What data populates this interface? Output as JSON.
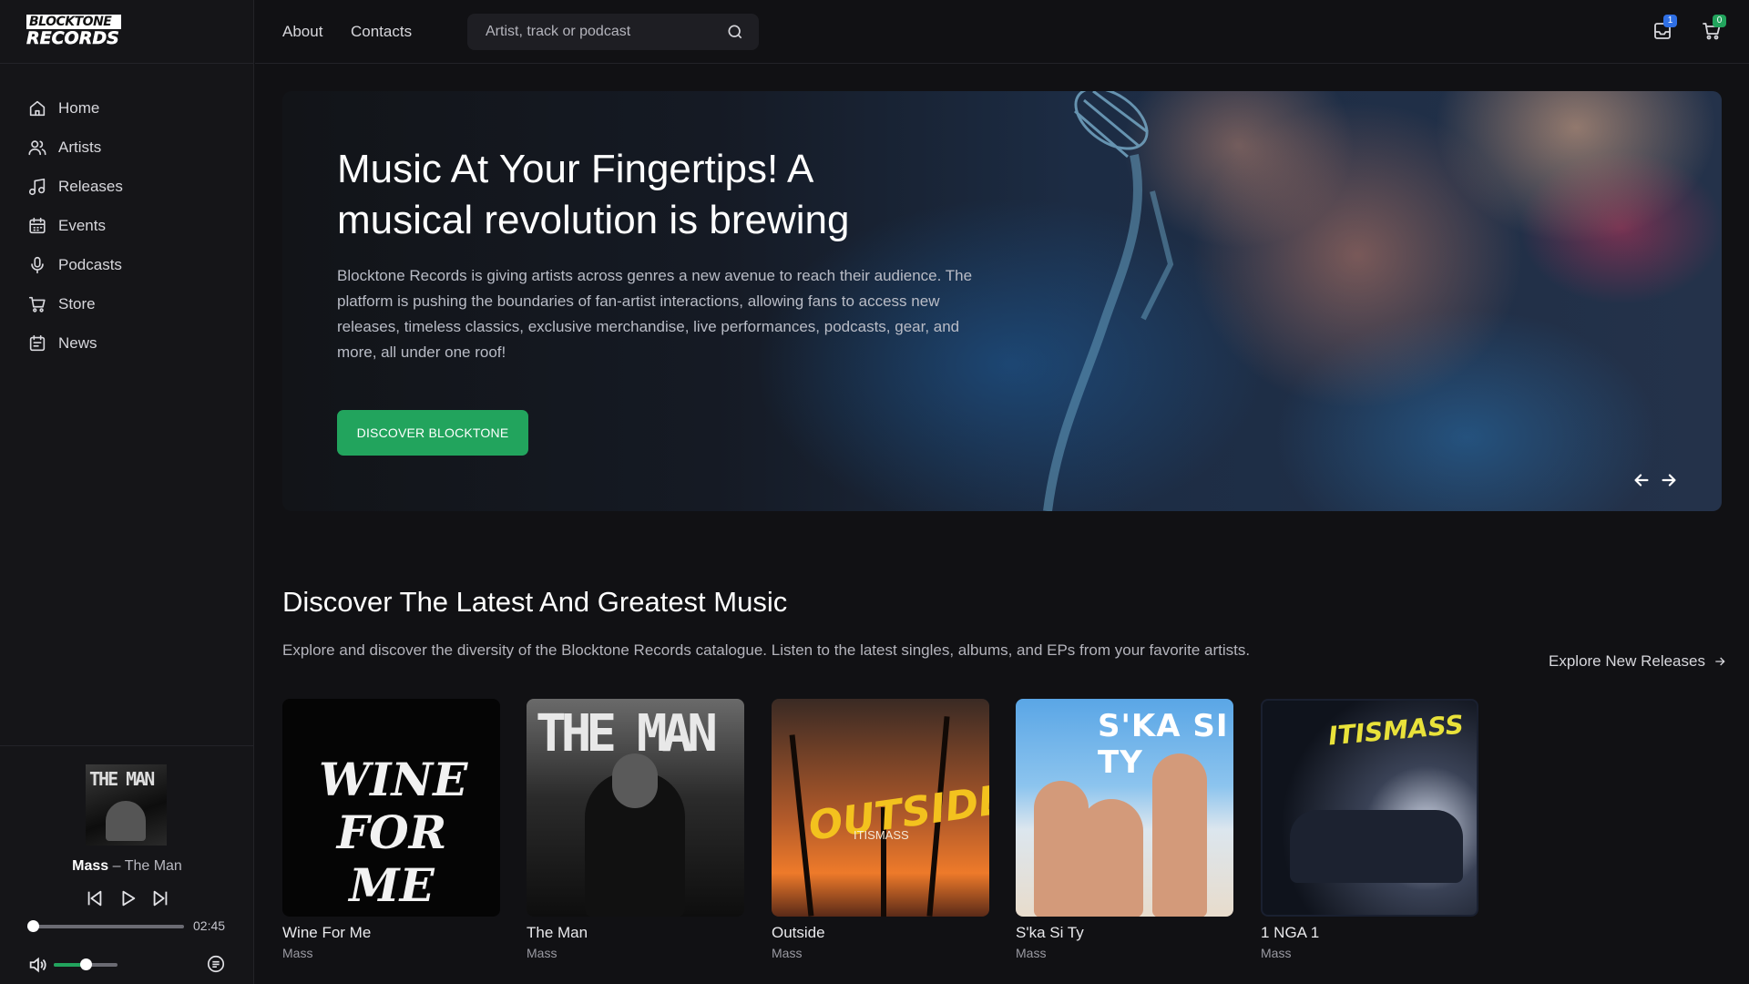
{
  "brand": {
    "line1": "BLOCKTONE",
    "line2": "RECORDS"
  },
  "sidebar": {
    "items": [
      {
        "label": "Home",
        "icon": "home-icon"
      },
      {
        "label": "Artists",
        "icon": "users-icon"
      },
      {
        "label": "Releases",
        "icon": "music-note-icon"
      },
      {
        "label": "Events",
        "icon": "calendar-icon"
      },
      {
        "label": "Podcasts",
        "icon": "microphone-icon"
      },
      {
        "label": "Store",
        "icon": "cart-icon"
      },
      {
        "label": "News",
        "icon": "news-icon"
      }
    ]
  },
  "player": {
    "artist": "Mass",
    "separator": " – ",
    "track": "The Man",
    "cover_text": "THE MAN",
    "duration": "02:45",
    "progress": 0.0,
    "volume": 0.5
  },
  "topbar": {
    "links": [
      "About",
      "Contacts"
    ],
    "search_placeholder": "Artist, track or podcast",
    "inbox_count": "1",
    "cart_count": "0"
  },
  "hero": {
    "title": "Music At Your Fingertips! A musical revolution is brewing",
    "text": "Blocktone Records is giving artists across genres a new avenue to reach their audience. The platform is pushing the boundaries of fan-artist interactions, allowing fans to access new releases, timeless classics, exclusive merchandise, live performances, podcasts, gear, and more, all under one roof!",
    "button": "DISCOVER BLOCKTONE"
  },
  "section": {
    "title": "Discover The Latest And Greatest Music",
    "subtitle": "Explore and discover the diversity of the Blocktone Records catalogue. Listen to the latest singles, albums, and EPs from your favorite artists.",
    "explore": "Explore New Releases"
  },
  "releases": [
    {
      "title": "Wine For Me",
      "artist": "Mass",
      "cover_text": "WINE FOR ME"
    },
    {
      "title": "The Man",
      "artist": "Mass",
      "cover_text": "THE MAN"
    },
    {
      "title": "Outside",
      "artist": "Mass",
      "cover_text": "OUTSIDE",
      "cover_sub": "ITISMASS"
    },
    {
      "title": "S'ka Si Ty",
      "artist": "Mass",
      "cover_text": "S'KA SI TY"
    },
    {
      "title": "1 NGA 1",
      "artist": "Mass",
      "cover_text": "ITISMASS"
    }
  ],
  "colors": {
    "accent": "#22a45d",
    "badge_inbox": "#2f6fe4",
    "badge_cart": "#22a45d",
    "background": "#111114"
  }
}
